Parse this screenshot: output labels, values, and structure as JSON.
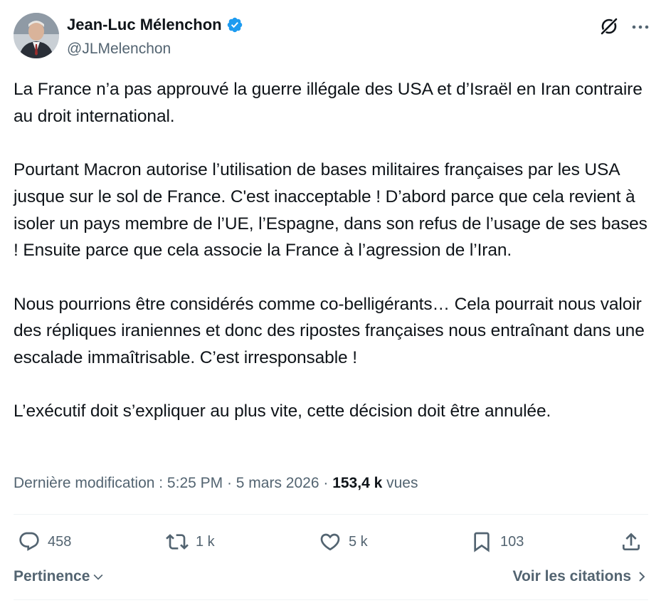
{
  "author": {
    "name": "Jean-Luc Mélenchon",
    "handle": "@JLMelenchon",
    "verified_color": "#1d9bf0"
  },
  "post": {
    "paragraphs": [
      "La France n’a pas approuvé la guerre illégale des USA et d’Israël en Iran contraire au droit international.",
      "Pourtant Macron autorise l’utilisation de bases militaires françaises par les USA jusque sur le sol de France. C'est inacceptable ! D’abord parce que cela revient à isoler un pays membre de l’UE, l’Espagne, dans son refus de l’usage de ses bases ! Ensuite parce que cela associe la France à l’agression de l’Iran.",
      "Nous pourrions être considérés comme co-belligérants… Cela pourrait nous valoir des répliques iraniennes et donc des ripostes françaises nous entraînant dans une escalade immaîtrisable. C’est irresponsable !",
      "L’exécutif doit s’expliquer au plus vite, cette décision doit être annulée."
    ]
  },
  "meta": {
    "edited_label": "Dernière modification : 5:25 PM · 5 mars 2026 · ",
    "views_count": "153,4 k",
    "views_label": " vues"
  },
  "actions": {
    "replies": "458",
    "retweets": "1 k",
    "likes": "5 k",
    "bookmarks": "103",
    "icons": [
      "reply-icon",
      "retweet-icon",
      "like-icon",
      "bookmark-icon",
      "share-icon"
    ]
  },
  "footer": {
    "sort_label": "Pertinence",
    "quotes_label": "Voir les citations"
  },
  "colors": {
    "text": "#0f1419",
    "secondary": "#536471",
    "divider": "#eff3f4",
    "verified": "#1d9bf0"
  }
}
